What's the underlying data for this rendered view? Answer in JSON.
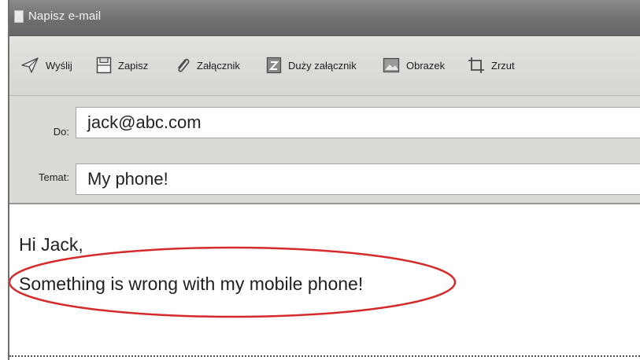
{
  "window": {
    "title": "Napisz e-mail"
  },
  "toolbar": {
    "send_label": "Wyślij",
    "save_label": "Zapisz",
    "attachment_label": "Załącznik",
    "large_attachment_label": "Duży załącznik",
    "image_label": "Obrazek",
    "screenshot_label": "Zrzut"
  },
  "fields": {
    "to_label": "Do:",
    "to_value": "jack@abc.com",
    "subject_label": "Temat:",
    "subject_value": "My phone!"
  },
  "body": {
    "greeting": "Hi Jack,",
    "message": "Something is wrong with my mobile phone!"
  },
  "colors": {
    "annotation_ring": "#d42a2a",
    "titlebar": "#7a7a7a",
    "toolbar": "#dcdad6"
  }
}
